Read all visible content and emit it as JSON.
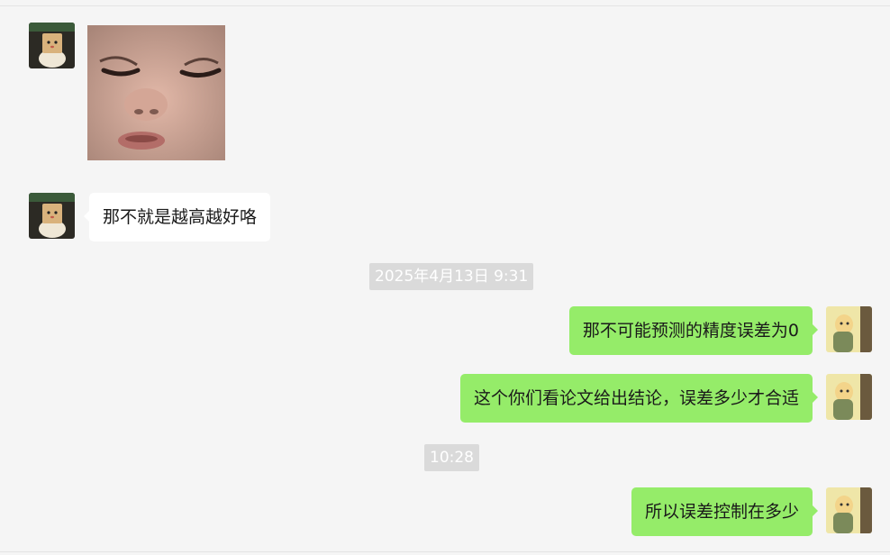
{
  "messages": [
    {
      "id": "m1",
      "side": "in",
      "type": "sticker",
      "sticker_icon": "baby-face-sticker"
    },
    {
      "id": "m2",
      "side": "in",
      "type": "text",
      "text": "那不就是越高越好咯"
    },
    {
      "id": "t1",
      "type": "timestamp",
      "text": "2025年4月13日 9:31"
    },
    {
      "id": "m3",
      "side": "out",
      "type": "text",
      "text": "那不可能预测的精度误差为0"
    },
    {
      "id": "m4",
      "side": "out",
      "type": "text",
      "text": "这个你们看论文给出结论，误差多少才合适"
    },
    {
      "id": "t2",
      "type": "timestamp",
      "text": "10:28"
    },
    {
      "id": "m5",
      "side": "out",
      "type": "text",
      "text": "所以误差控制在多少"
    }
  ],
  "avatars": {
    "contact_icon": "box-head-plush-avatar",
    "self_icon": "cartoon-character-avatar"
  },
  "colors": {
    "background": "#f5f5f5",
    "incoming_bubble": "#ffffff",
    "outgoing_bubble": "#95ec69",
    "timestamp_bg": "#dadada"
  }
}
